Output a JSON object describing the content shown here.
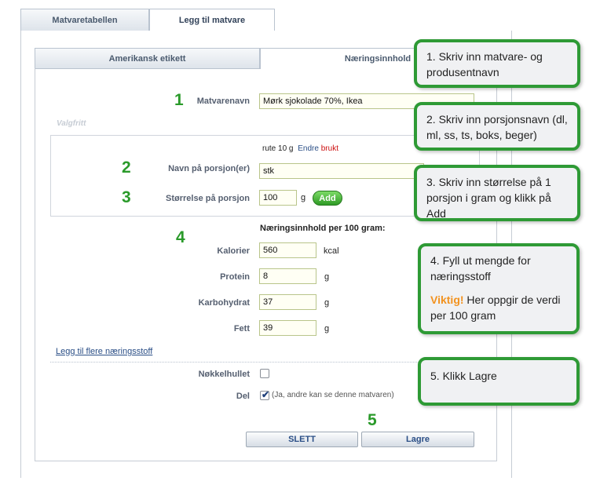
{
  "tabs": {
    "food_table": "Matvaretabellen",
    "add_food": "Legg til matvare"
  },
  "subtabs": {
    "american_label": "Amerikansk etikett",
    "nutrition": "Næringsinnhold"
  },
  "form": {
    "food_name_label": "Matvarenavn",
    "food_name_value": "Mørk sjokolade 70%, Ikea",
    "optional_label": "Valgfritt",
    "portion_info": "rute 10 g",
    "edit_link": "Endre",
    "use_link": "brukt",
    "portion_name_label": "Navn på porsjon(er)",
    "portion_name_value": "stk",
    "portion_size_label": "Størrelse på porsjon",
    "portion_size_value": "100",
    "portion_size_unit": "g",
    "add_button": "Add",
    "nutrition_header": "Næringsinnhold per 100 gram:",
    "nutrients": [
      {
        "label": "Kalorier",
        "value": "560",
        "unit": "kcal"
      },
      {
        "label": "Protein",
        "value": "8",
        "unit": "g"
      },
      {
        "label": "Karbohydrat",
        "value": "37",
        "unit": "g"
      },
      {
        "label": "Fett",
        "value": "39",
        "unit": "g"
      }
    ],
    "more_nutrients_link": "Legg til flere næringsstoff",
    "keyhole_label": "Nøkkelhullet",
    "share_label": "Del",
    "share_text": "(Ja, andre kan se denne matvaren)",
    "delete_button": "SLETT",
    "save_button": "Lagre"
  },
  "steps": {
    "s1": "1",
    "s2": "2",
    "s3": "3",
    "s4": "4",
    "s5": "5"
  },
  "callouts": {
    "c1": "1. Skriv inn matvare- og produsentnavn",
    "c2": "2. Skriv inn porsjonsnavn (dl, ml, ss, ts, boks, beger)",
    "c3": "3. Skriv inn størrelse på 1 porsjon i gram og klikk på Add",
    "c4_line": "4. Fyll ut mengde for næringsstoff",
    "c4_important": "Viktig!",
    "c4_rest": " Her oppgir de verdi per 100 gram",
    "c5": "5. Klikk Lagre"
  },
  "colors": {
    "accent_green": "#2e9a35",
    "important_orange": "#f2921f",
    "link_blue": "#2a4e86",
    "link_red": "#cc1111"
  }
}
